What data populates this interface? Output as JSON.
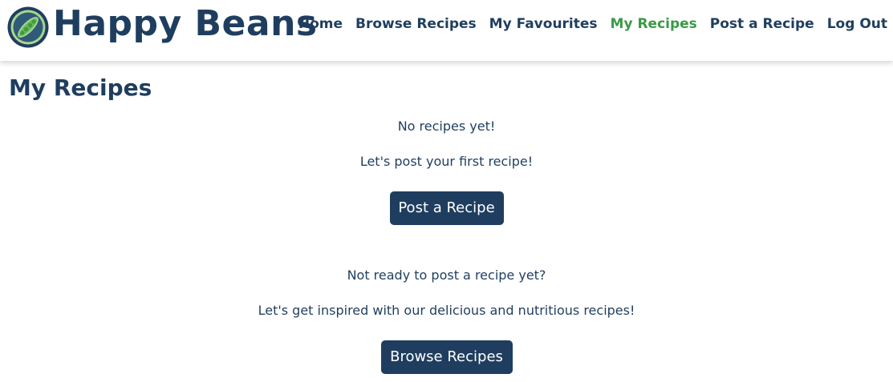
{
  "brand": {
    "name": "Happy Beans",
    "logo_icon": "pea-pod-icon",
    "colors": {
      "navy": "#1f3e5f",
      "green": "#3a9a46",
      "light_green": "#a8d68f"
    }
  },
  "nav": {
    "items": [
      {
        "label": "Home",
        "active": false
      },
      {
        "label": "Browse Recipes",
        "active": false
      },
      {
        "label": "My Favourites",
        "active": false
      },
      {
        "label": "My Recipes",
        "active": true
      },
      {
        "label": "Post a Recipe",
        "active": false
      },
      {
        "label": "Log Out",
        "active": false
      }
    ]
  },
  "page": {
    "title": "My Recipes",
    "empty_message": "No recipes yet!",
    "prompt_post": "Let's post your first recipe!",
    "post_button": "Post a Recipe",
    "not_ready": "Not ready to post a recipe yet?",
    "prompt_browse": "Let's get inspired with our delicious and nutritious recipes!",
    "browse_button": "Browse Recipes"
  }
}
